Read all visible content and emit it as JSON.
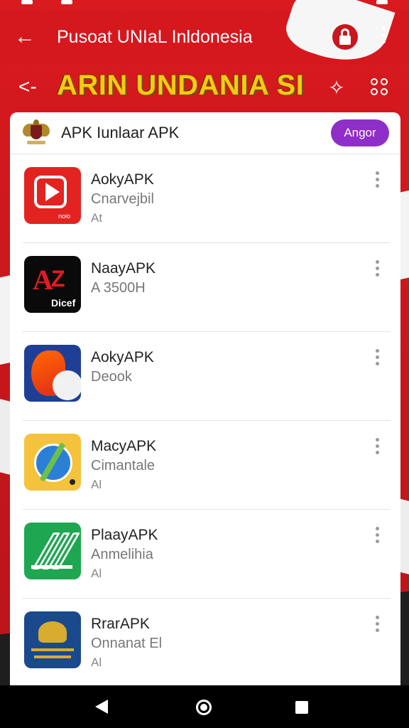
{
  "appbar": {
    "title": "Pusoat UNIaL Inldonesia",
    "back_icon": "arrow-left-icon",
    "lock_icon": "lock-icon"
  },
  "banner": {
    "title": "ARIN UNDANIA SI",
    "title_color": "#f6c915"
  },
  "card": {
    "title": "APK Iunlaar APK",
    "action_label": "Angor",
    "action_color": "#8e2fc7"
  },
  "apps": [
    {
      "name": "AokyAPK",
      "sub": "Cnarvejbil",
      "sub2": "At"
    },
    {
      "name": "NaayAPK",
      "sub": "A 3500H",
      "sub2": ""
    },
    {
      "name": "AokyAPK",
      "sub": "Deook",
      "sub2": ""
    },
    {
      "name": "MacyAPK",
      "sub": "Cimantale",
      "sub2": "Al"
    },
    {
      "name": "PlaayAPK",
      "sub": "Anmelihia",
      "sub2": "Al"
    },
    {
      "name": "RrarAPK",
      "sub": "Onnanat El",
      "sub2": "Al"
    }
  ],
  "icon_captions": {
    "app1": "noio",
    "app2": "Dicef"
  },
  "colors": {
    "primary_red": "#d5181e",
    "navbar": "#000000"
  }
}
